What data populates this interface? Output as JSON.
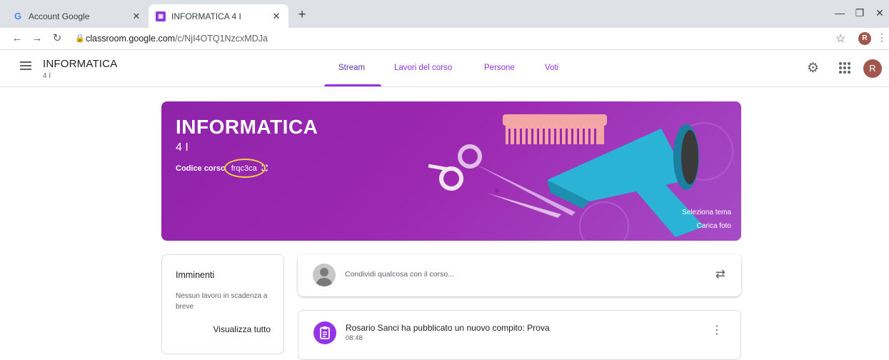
{
  "browser": {
    "tabs": [
      {
        "title": "Account Google",
        "favicon": "google-g-icon",
        "active": false
      },
      {
        "title": "INFORMATICA 4 I",
        "favicon": "classroom-icon",
        "active": true
      }
    ],
    "new_tab": "+",
    "url_host": "classroom.google.com",
    "url_path": "/c/NjI4OTQ1NzcxMDJa",
    "profile_initial": "R"
  },
  "header": {
    "title": "INFORMATICA",
    "subtitle": "4 I",
    "tabs": [
      {
        "label": "Stream",
        "active": true
      },
      {
        "label": "Lavori del corso",
        "active": false
      },
      {
        "label": "Persone",
        "active": false
      },
      {
        "label": "Voti",
        "active": false
      }
    ],
    "avatar_initial": "R",
    "accent": "#9334e6"
  },
  "banner": {
    "title": "INFORMATICA",
    "section": "4 I",
    "code_label": "Codice corso",
    "code_value": "frqc3ca",
    "select_theme": "Seleziona tema",
    "upload_photo": "Carica foto",
    "color": "#9c27b0"
  },
  "upcoming": {
    "title": "Imminenti",
    "empty_text": "Nessun lavoro in scadenza a breve",
    "view_all": "Visualizza tutto"
  },
  "share": {
    "placeholder": "Condividi qualcosa con il corso..."
  },
  "posts": [
    {
      "title": "Rosario Sanci ha pubblicato un nuovo compito: Prova",
      "time": "08:48"
    }
  ]
}
